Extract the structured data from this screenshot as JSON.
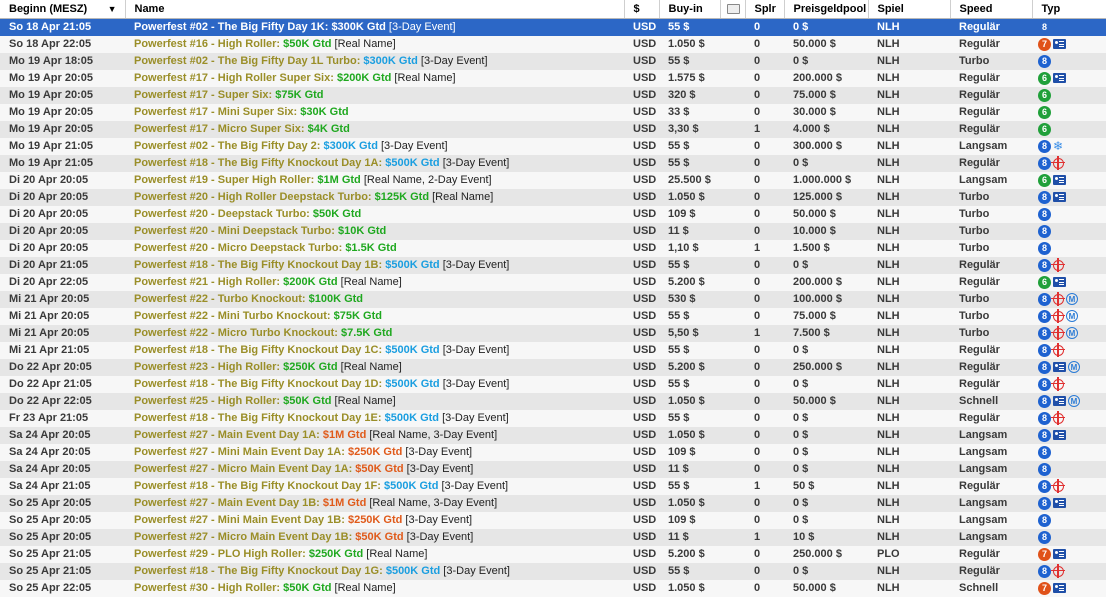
{
  "header": {
    "beginn": "Beginn (MESZ)",
    "name": "Name",
    "currency": "$",
    "buyin": "Buy-in",
    "ticket_icon": "ticket-icon",
    "splr": "Splr",
    "pool": "Preisgeldpool",
    "spiel": "Spiel",
    "speed": "Speed",
    "typ": "Typ"
  },
  "colors": {
    "selected": "#2c67c6",
    "gold": "#9a8e28",
    "gtd_green": "#1fa81f",
    "gtd_blue": "#1a9ee0",
    "gtd_orange": "#e05a1a"
  },
  "rows": [
    {
      "beginn": "So 18 Apr 21:05",
      "title": "Powerfest #02 - The Big Fifty Day 1K: ",
      "gtd": "$300K Gtd",
      "note": " [3-Day Event]",
      "gtdc": "blue",
      "cur": "USD",
      "buyin": "55 $",
      "splr": "0",
      "pool": "0 $",
      "spiel": "NLH",
      "speed": "Regulär",
      "badge": "8",
      "extras": []
    },
    {
      "beginn": "So 18 Apr 22:05",
      "title": "Powerfest #16 - High Roller: ",
      "gtd": "$50K Gtd",
      "note": " [Real Name]",
      "gtdc": "green",
      "cur": "USD",
      "buyin": "1.050 $",
      "splr": "0",
      "pool": "50.000 $",
      "spiel": "NLH",
      "speed": "Regulär",
      "badge": "7",
      "extras": [
        "card"
      ]
    },
    {
      "beginn": "Mo 19 Apr 18:05",
      "title": "Powerfest #02 - The Big Fifty Day 1L Turbo: ",
      "gtd": "$300K Gtd",
      "note": " [3-Day Event]",
      "gtdc": "blue",
      "cur": "USD",
      "buyin": "55 $",
      "splr": "0",
      "pool": "0 $",
      "spiel": "NLH",
      "speed": "Turbo",
      "badge": "8",
      "extras": []
    },
    {
      "beginn": "Mo 19 Apr 20:05",
      "title": "Powerfest #17 - High Roller Super Six: ",
      "gtd": "$200K Gtd",
      "note": " [Real Name]",
      "gtdc": "green",
      "cur": "USD",
      "buyin": "1.575 $",
      "splr": "0",
      "pool": "200.000 $",
      "spiel": "NLH",
      "speed": "Regulär",
      "badge": "6",
      "extras": [
        "card"
      ]
    },
    {
      "beginn": "Mo 19 Apr 20:05",
      "title": "Powerfest #17 - Super Six: ",
      "gtd": "$75K Gtd",
      "note": "",
      "gtdc": "green",
      "cur": "USD",
      "buyin": "320 $",
      "splr": "0",
      "pool": "75.000 $",
      "spiel": "NLH",
      "speed": "Regulär",
      "badge": "6",
      "extras": []
    },
    {
      "beginn": "Mo 19 Apr 20:05",
      "title": "Powerfest #17 - Mini Super Six: ",
      "gtd": "$30K Gtd",
      "note": "",
      "gtdc": "green",
      "cur": "USD",
      "buyin": "33 $",
      "splr": "0",
      "pool": "30.000 $",
      "spiel": "NLH",
      "speed": "Regulär",
      "badge": "6",
      "extras": []
    },
    {
      "beginn": "Mo 19 Apr 20:05",
      "title": "Powerfest #17 - Micro Super Six: ",
      "gtd": "$4K Gtd",
      "note": "",
      "gtdc": "green",
      "cur": "USD",
      "buyin": "3,30 $",
      "splr": "1",
      "pool": "4.000 $",
      "spiel": "NLH",
      "speed": "Regulär",
      "badge": "6",
      "extras": []
    },
    {
      "beginn": "Mo 19 Apr 21:05",
      "title": "Powerfest #02 - The Big Fifty Day 2: ",
      "gtd": "$300K Gtd",
      "note": " [3-Day Event]",
      "gtdc": "blue",
      "cur": "USD",
      "buyin": "55 $",
      "splr": "0",
      "pool": "300.000 $",
      "spiel": "NLH",
      "speed": "Langsam",
      "badge": "8",
      "extras": [
        "snow"
      ]
    },
    {
      "beginn": "Mo 19 Apr 21:05",
      "title": "Powerfest #18 - The Big Fifty Knockout Day 1A: ",
      "gtd": "$500K Gtd",
      "note": " [3-Day Event]",
      "gtdc": "blue",
      "cur": "USD",
      "buyin": "55 $",
      "splr": "0",
      "pool": "0 $",
      "spiel": "NLH",
      "speed": "Regulär",
      "badge": "8",
      "extras": [
        "target"
      ]
    },
    {
      "beginn": "Di 20 Apr 20:05",
      "title": "Powerfest #19 - Super High Roller: ",
      "gtd": "$1M Gtd",
      "note": " [Real Name, 2-Day Event]",
      "gtdc": "green",
      "cur": "USD",
      "buyin": "25.500 $",
      "splr": "0",
      "pool": "1.000.000 $",
      "spiel": "NLH",
      "speed": "Langsam",
      "badge": "6",
      "extras": [
        "card"
      ]
    },
    {
      "beginn": "Di 20 Apr 20:05",
      "title": "Powerfest #20 - High Roller Deepstack Turbo: ",
      "gtd": "$125K Gtd",
      "note": " [Real Name]",
      "gtdc": "green",
      "cur": "USD",
      "buyin": "1.050 $",
      "splr": "0",
      "pool": "125.000 $",
      "spiel": "NLH",
      "speed": "Turbo",
      "badge": "8",
      "extras": [
        "card"
      ]
    },
    {
      "beginn": "Di 20 Apr 20:05",
      "title": "Powerfest #20 - Deepstack Turbo: ",
      "gtd": "$50K Gtd",
      "note": "",
      "gtdc": "green",
      "cur": "USD",
      "buyin": "109 $",
      "splr": "0",
      "pool": "50.000 $",
      "spiel": "NLH",
      "speed": "Turbo",
      "badge": "8",
      "extras": []
    },
    {
      "beginn": "Di 20 Apr 20:05",
      "title": "Powerfest #20 - Mini Deepstack Turbo: ",
      "gtd": "$10K Gtd",
      "note": "",
      "gtdc": "green",
      "cur": "USD",
      "buyin": "11 $",
      "splr": "0",
      "pool": "10.000 $",
      "spiel": "NLH",
      "speed": "Turbo",
      "badge": "8",
      "extras": []
    },
    {
      "beginn": "Di 20 Apr 20:05",
      "title": "Powerfest #20 - Micro Deepstack Turbo: ",
      "gtd": "$1.5K Gtd",
      "note": "",
      "gtdc": "green",
      "cur": "USD",
      "buyin": "1,10 $",
      "splr": "1",
      "pool": "1.500 $",
      "spiel": "NLH",
      "speed": "Turbo",
      "badge": "8",
      "extras": []
    },
    {
      "beginn": "Di 20 Apr 21:05",
      "title": "Powerfest #18 - The Big Fifty Knockout Day 1B: ",
      "gtd": "$500K Gtd",
      "note": " [3-Day Event]",
      "gtdc": "blue",
      "cur": "USD",
      "buyin": "55 $",
      "splr": "0",
      "pool": "0 $",
      "spiel": "NLH",
      "speed": "Regulär",
      "badge": "8",
      "extras": [
        "target"
      ]
    },
    {
      "beginn": "Di 20 Apr 22:05",
      "title": "Powerfest #21 - High Roller: ",
      "gtd": "$200K Gtd",
      "note": " [Real Name]",
      "gtdc": "green",
      "cur": "USD",
      "buyin": "5.200 $",
      "splr": "0",
      "pool": "200.000 $",
      "spiel": "NLH",
      "speed": "Regulär",
      "badge": "6",
      "extras": [
        "card"
      ]
    },
    {
      "beginn": "Mi 21 Apr 20:05",
      "title": "Powerfest #22 - Turbo Knockout: ",
      "gtd": "$100K Gtd",
      "note": "",
      "gtdc": "green",
      "cur": "USD",
      "buyin": "530 $",
      "splr": "0",
      "pool": "100.000 $",
      "spiel": "NLH",
      "speed": "Turbo",
      "badge": "8",
      "extras": [
        "target",
        "m"
      ]
    },
    {
      "beginn": "Mi 21 Apr 20:05",
      "title": "Powerfest #22 - Mini Turbo Knockout: ",
      "gtd": "$75K Gtd",
      "note": "",
      "gtdc": "green",
      "cur": "USD",
      "buyin": "55 $",
      "splr": "0",
      "pool": "75.000 $",
      "spiel": "NLH",
      "speed": "Turbo",
      "badge": "8",
      "extras": [
        "target",
        "m"
      ]
    },
    {
      "beginn": "Mi 21 Apr 20:05",
      "title": "Powerfest #22 - Micro Turbo Knockout: ",
      "gtd": "$7.5K Gtd",
      "note": "",
      "gtdc": "green",
      "cur": "USD",
      "buyin": "5,50 $",
      "splr": "1",
      "pool": "7.500 $",
      "spiel": "NLH",
      "speed": "Turbo",
      "badge": "8",
      "extras": [
        "target",
        "m"
      ]
    },
    {
      "beginn": "Mi 21 Apr 21:05",
      "title": "Powerfest #18 - The Big Fifty Knockout Day 1C: ",
      "gtd": "$500K Gtd",
      "note": " [3-Day Event]",
      "gtdc": "blue",
      "cur": "USD",
      "buyin": "55 $",
      "splr": "0",
      "pool": "0 $",
      "spiel": "NLH",
      "speed": "Regulär",
      "badge": "8",
      "extras": [
        "target"
      ]
    },
    {
      "beginn": "Do 22 Apr 20:05",
      "title": "Powerfest #23 - High Roller: ",
      "gtd": "$250K Gtd",
      "note": " [Real Name]",
      "gtdc": "green",
      "cur": "USD",
      "buyin": "5.200 $",
      "splr": "0",
      "pool": "250.000 $",
      "spiel": "NLH",
      "speed": "Regulär",
      "badge": "8",
      "extras": [
        "card",
        "m"
      ]
    },
    {
      "beginn": "Do 22 Apr 21:05",
      "title": "Powerfest #18 - The Big Fifty Knockout Day 1D: ",
      "gtd": "$500K Gtd",
      "note": " [3-Day Event]",
      "gtdc": "blue",
      "cur": "USD",
      "buyin": "55 $",
      "splr": "0",
      "pool": "0 $",
      "spiel": "NLH",
      "speed": "Regulär",
      "badge": "8",
      "extras": [
        "target"
      ]
    },
    {
      "beginn": "Do 22 Apr 22:05",
      "title": "Powerfest #25 - High Roller: ",
      "gtd": "$50K Gtd",
      "note": " [Real Name]",
      "gtdc": "green",
      "cur": "USD",
      "buyin": "1.050 $",
      "splr": "0",
      "pool": "50.000 $",
      "spiel": "NLH",
      "speed": "Schnell",
      "badge": "8",
      "extras": [
        "card",
        "m"
      ]
    },
    {
      "beginn": "Fr 23 Apr 21:05",
      "title": "Powerfest #18 - The Big Fifty Knockout Day 1E: ",
      "gtd": "$500K Gtd",
      "note": " [3-Day Event]",
      "gtdc": "blue",
      "cur": "USD",
      "buyin": "55 $",
      "splr": "0",
      "pool": "0 $",
      "spiel": "NLH",
      "speed": "Regulär",
      "badge": "8",
      "extras": [
        "target"
      ]
    },
    {
      "beginn": "Sa 24 Apr 20:05",
      "title": "Powerfest #27 - Main Event Day 1A: ",
      "gtd": "$1M Gtd",
      "note": " [Real Name, 3-Day Event]",
      "gtdc": "orange",
      "cur": "USD",
      "buyin": "1.050 $",
      "splr": "0",
      "pool": "0 $",
      "spiel": "NLH",
      "speed": "Langsam",
      "badge": "8",
      "extras": [
        "card"
      ]
    },
    {
      "beginn": "Sa 24 Apr 20:05",
      "title": "Powerfest #27 - Mini Main Event Day 1A: ",
      "gtd": "$250K Gtd",
      "note": " [3-Day Event]",
      "gtdc": "orange",
      "cur": "USD",
      "buyin": "109 $",
      "splr": "0",
      "pool": "0 $",
      "spiel": "NLH",
      "speed": "Langsam",
      "badge": "8",
      "extras": []
    },
    {
      "beginn": "Sa 24 Apr 20:05",
      "title": "Powerfest #27 - Micro Main Event Day 1A: ",
      "gtd": "$50K Gtd",
      "note": " [3-Day Event]",
      "gtdc": "orange",
      "cur": "USD",
      "buyin": "11 $",
      "splr": "0",
      "pool": "0 $",
      "spiel": "NLH",
      "speed": "Langsam",
      "badge": "8",
      "extras": []
    },
    {
      "beginn": "Sa 24 Apr 21:05",
      "title": "Powerfest #18 - The Big Fifty Knockout Day 1F: ",
      "gtd": "$500K Gtd",
      "note": " [3-Day Event]",
      "gtdc": "blue",
      "cur": "USD",
      "buyin": "55 $",
      "splr": "1",
      "pool": "50 $",
      "spiel": "NLH",
      "speed": "Regulär",
      "badge": "8",
      "extras": [
        "target"
      ]
    },
    {
      "beginn": "So 25 Apr 20:05",
      "title": "Powerfest #27 - Main Event Day 1B: ",
      "gtd": "$1M Gtd",
      "note": " [Real Name, 3-Day Event]",
      "gtdc": "orange",
      "cur": "USD",
      "buyin": "1.050 $",
      "splr": "0",
      "pool": "0 $",
      "spiel": "NLH",
      "speed": "Langsam",
      "badge": "8",
      "extras": [
        "card"
      ]
    },
    {
      "beginn": "So 25 Apr 20:05",
      "title": "Powerfest #27 - Mini Main Event Day 1B: ",
      "gtd": "$250K Gtd",
      "note": " [3-Day Event]",
      "gtdc": "orange",
      "cur": "USD",
      "buyin": "109 $",
      "splr": "0",
      "pool": "0 $",
      "spiel": "NLH",
      "speed": "Langsam",
      "badge": "8",
      "extras": []
    },
    {
      "beginn": "So 25 Apr 20:05",
      "title": "Powerfest #27 - Micro Main Event Day 1B: ",
      "gtd": "$50K Gtd",
      "note": " [3-Day Event]",
      "gtdc": "orange",
      "cur": "USD",
      "buyin": "11 $",
      "splr": "1",
      "pool": "10 $",
      "spiel": "NLH",
      "speed": "Langsam",
      "badge": "8",
      "extras": []
    },
    {
      "beginn": "So 25 Apr 21:05",
      "title": "Powerfest #29 - PLO High Roller: ",
      "gtd": "$250K Gtd",
      "note": " [Real Name]",
      "gtdc": "green",
      "cur": "USD",
      "buyin": "5.200 $",
      "splr": "0",
      "pool": "250.000 $",
      "spiel": "PLO",
      "speed": "Regulär",
      "badge": "7",
      "extras": [
        "card"
      ]
    },
    {
      "beginn": "So 25 Apr 21:05",
      "title": "Powerfest #18 - The Big Fifty Knockout Day 1G: ",
      "gtd": "$500K Gtd",
      "note": " [3-Day Event]",
      "gtdc": "blue",
      "cur": "USD",
      "buyin": "55 $",
      "splr": "0",
      "pool": "0 $",
      "spiel": "NLH",
      "speed": "Regulär",
      "badge": "8",
      "extras": [
        "target"
      ]
    },
    {
      "beginn": "So 25 Apr 22:05",
      "title": "Powerfest #30 - High Roller: ",
      "gtd": "$50K Gtd",
      "note": " [Real Name]",
      "gtdc": "green",
      "cur": "USD",
      "buyin": "1.050 $",
      "splr": "0",
      "pool": "50.000 $",
      "spiel": "NLH",
      "speed": "Schnell",
      "badge": "7",
      "extras": [
        "card"
      ]
    }
  ]
}
